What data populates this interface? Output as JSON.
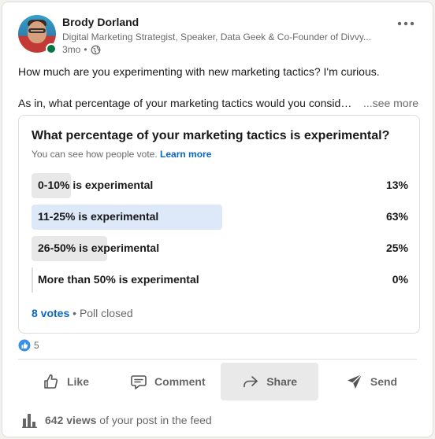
{
  "author": {
    "name": "Brody Dorland",
    "headline": "Digital Marketing Strategist, Speaker, Data Geek & Co-Founder of Divvy...",
    "time": "3mo",
    "online": true
  },
  "post": {
    "line1": "How much are you experimenting with new marketing tactics? I'm curious.",
    "line2": "As in, what percentage of your marketing tactics would you consider experimental?",
    "see_more": "...see more"
  },
  "poll": {
    "question": "What percentage of your marketing tactics is experimental?",
    "subtitle": "You can see how people vote.",
    "learn_more": "Learn more",
    "options": [
      {
        "label": "0-10% is experimental",
        "percent": "13%",
        "share": 0.13,
        "winner": false
      },
      {
        "label": "11-25% is experimental",
        "percent": "63%",
        "share": 0.63,
        "winner": true
      },
      {
        "label": "26-50% is experimental",
        "percent": "25%",
        "share": 0.25,
        "winner": false
      },
      {
        "label": "More than 50% is experimental",
        "percent": "0%",
        "share": 0.0,
        "winner": false
      }
    ],
    "votes": "8 votes",
    "status": "Poll closed"
  },
  "reactions": {
    "count": "5"
  },
  "actions": {
    "like": "Like",
    "comment": "Comment",
    "share": "Share",
    "send": "Send",
    "active": "share"
  },
  "analytics": {
    "views_count": "642 views",
    "views_suffix": "of your post in the feed"
  },
  "colors": {
    "accent": "#0a66c2",
    "winner_bar": "#dde9f9",
    "bar": "#e8e8e8",
    "online": "#057642"
  },
  "icons": {
    "more": "more-horizontal-icon",
    "visibility": "globe-icon",
    "reaction": "like-reaction-icon",
    "like": "thumbs-up-icon",
    "comment": "comment-bubble-icon",
    "share": "share-arrow-icon",
    "send": "paper-plane-icon",
    "views": "bar-chart-icon"
  }
}
